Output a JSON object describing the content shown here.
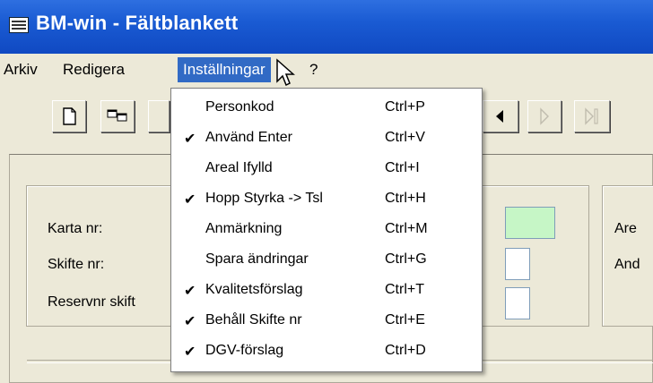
{
  "window": {
    "title": "BM-win - Fältblankett"
  },
  "menubar": {
    "items": [
      {
        "label": "Arkiv"
      },
      {
        "label": "Redigera"
      },
      {
        "label": "Inställningar"
      },
      {
        "label": "?"
      }
    ]
  },
  "settings_menu": {
    "items": [
      {
        "label": "Personkod",
        "shortcut": "Ctrl+P",
        "checked": false
      },
      {
        "label": "Använd Enter",
        "shortcut": "Ctrl+V",
        "checked": true
      },
      {
        "label": "Areal Ifylld",
        "shortcut": "Ctrl+I",
        "checked": false
      },
      {
        "label": "Hopp Styrka -> Tsl",
        "shortcut": "Ctrl+H",
        "checked": true
      },
      {
        "label": "Anmärkning",
        "shortcut": "Ctrl+M",
        "checked": false
      },
      {
        "label": "Spara ändringar",
        "shortcut": "Ctrl+G",
        "checked": false
      },
      {
        "label": "Kvalitetsförslag",
        "shortcut": "Ctrl+T",
        "checked": true
      },
      {
        "label": "Behåll Skifte nr",
        "shortcut": "Ctrl+E",
        "checked": true
      },
      {
        "label": "DGV-förslag",
        "shortcut": "Ctrl+D",
        "checked": true
      }
    ]
  },
  "form": {
    "labels": {
      "karta": "Karta nr:",
      "skifte": "Skifte nr:",
      "reservnr": "Reservnr skift",
      "right1": "Are",
      "right2": "And"
    }
  },
  "glyphs": {
    "check": "✔"
  }
}
